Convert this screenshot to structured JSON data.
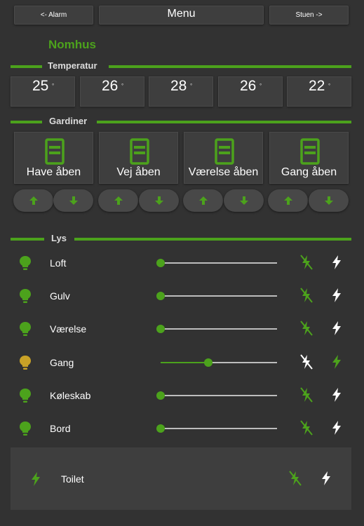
{
  "nav": {
    "prev_label": "<- Alarm",
    "menu_label": "Menu",
    "next_label": "Stuen ->"
  },
  "page_title": "Nomhus",
  "colors": {
    "accent": "#4ca21c",
    "bulb_on": "#c9a227",
    "background": "#323232"
  },
  "temperature": {
    "section_label": "Temperatur",
    "unit": "°",
    "readings": [
      "25",
      "26",
      "28",
      "26",
      "22"
    ]
  },
  "curtains": {
    "section_label": "Gardiner",
    "items": [
      {
        "label": "Have åben"
      },
      {
        "label": "Vej åben"
      },
      {
        "label": "Værelse åben"
      },
      {
        "label": "Gang åben"
      }
    ]
  },
  "lights": {
    "section_label": "Lys",
    "items": [
      {
        "label": "Loft",
        "level": 0,
        "state": "off"
      },
      {
        "label": "Gulv",
        "level": 0,
        "state": "off"
      },
      {
        "label": "Værelse",
        "level": 0,
        "state": "off"
      },
      {
        "label": "Gang",
        "level": 0.41,
        "state": "on"
      },
      {
        "label": "Køleskab",
        "level": 0,
        "state": "off"
      },
      {
        "label": "Bord",
        "level": 0,
        "state": "off"
      }
    ]
  },
  "toilet": {
    "label": "Toilet",
    "state": "off"
  }
}
